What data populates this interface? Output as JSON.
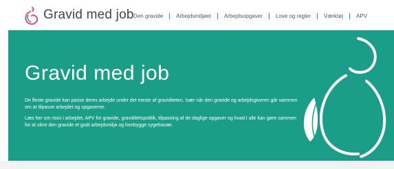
{
  "header": {
    "brand": "Gravid med job",
    "logo_icon": "pregnant-woman-logo-icon",
    "nav": [
      {
        "label": "Den gravide"
      },
      {
        "label": "Arbejdsmiljøet"
      },
      {
        "label": "Arbejdsopgaver"
      },
      {
        "label": "Love og regler"
      },
      {
        "label": "Værktøj"
      },
      {
        "label": "APV"
      }
    ]
  },
  "hero": {
    "title": "Gravid med job",
    "paragraph1": "De fleste gravide kan passe deres arbejde under det meste af graviditeten. Især når den gravide og arbejdsgiveren går sammen om at tilpasse arbejdet og opgaverne.",
    "paragraph2": "Læs her om risici i arbejdet, APV for gravide, graviditetspolitik, tilpasning af de daglige opgaver og hvad I alle kan gøre sammen for at sikre den gravide et godt arbejdsmiljø og forebygge sygefravær.",
    "illustration_icon": "pregnant-silhouette-icon"
  },
  "colors": {
    "accent": "#1a9e87",
    "text_light": "#ffffff",
    "nav_text": "#555555"
  }
}
